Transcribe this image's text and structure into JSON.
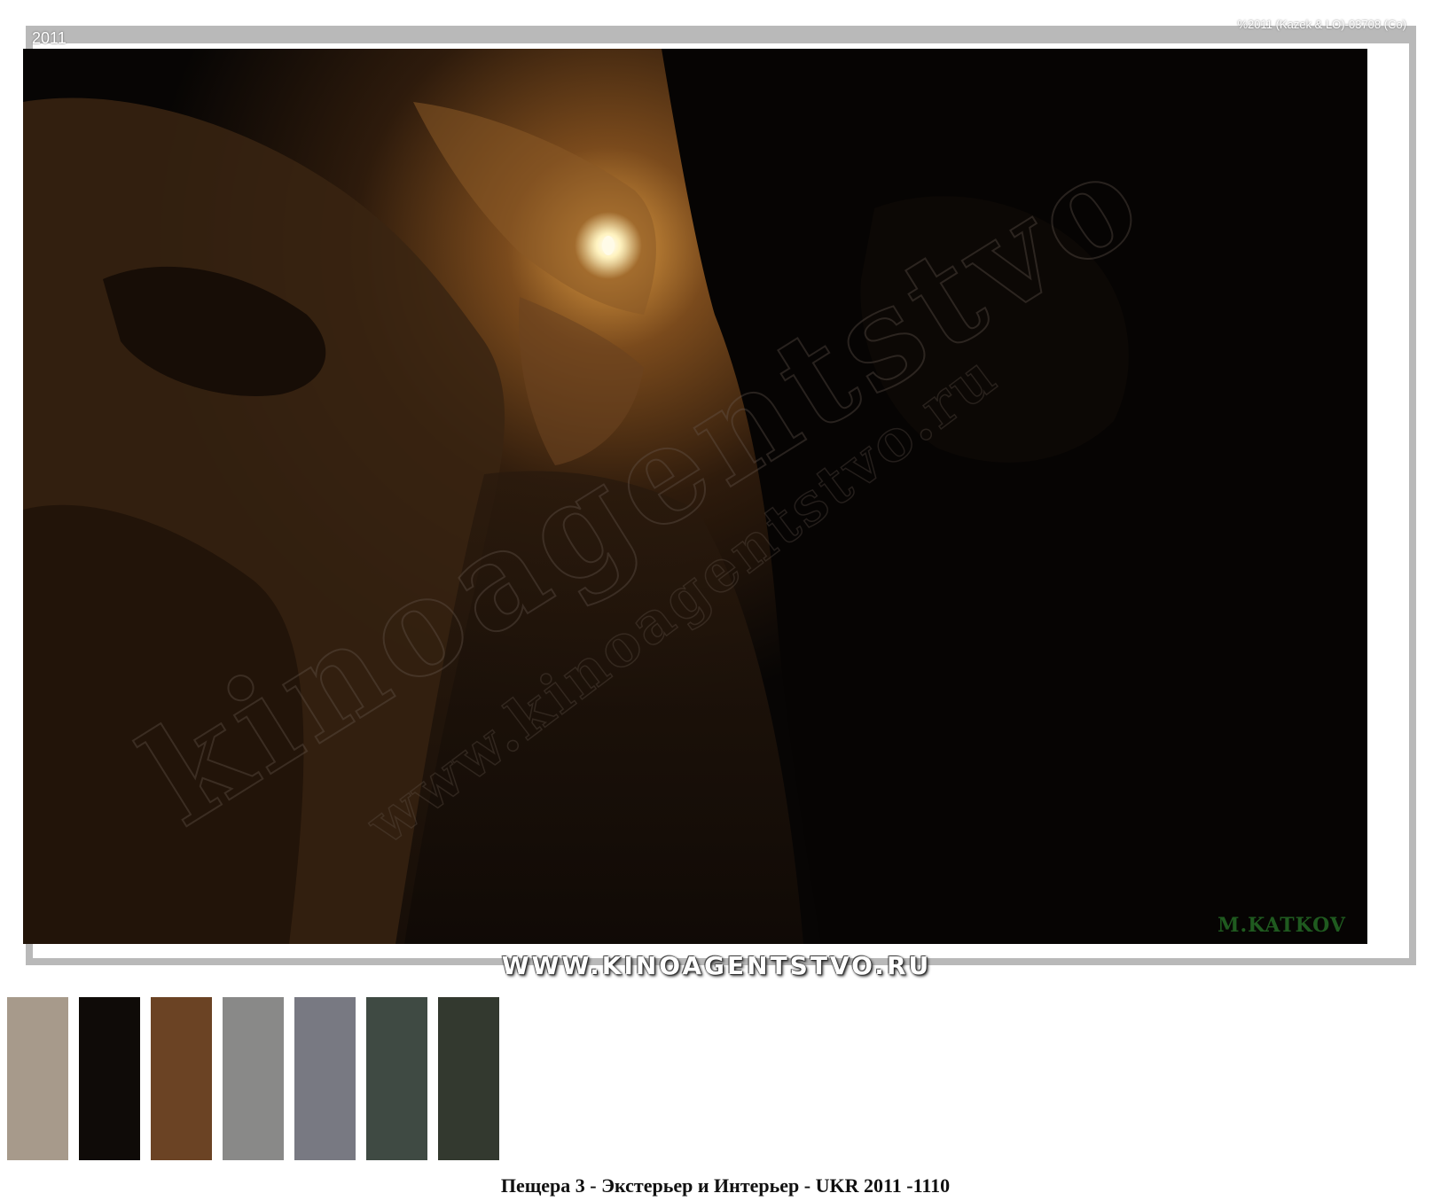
{
  "header": {
    "year": "2011",
    "copyright": "%2011 (Kazek & LO)-03708 (Co)"
  },
  "photo": {
    "watermark_large": "kinoagentstvo",
    "watermark_url": "www.kinoagentstvo.ru",
    "signature": "M.KATKOV",
    "colors": {
      "rock_light": "#7a4a1c",
      "rock_dark": "#1a0f07",
      "light": "#fff3c0",
      "shadow": "#050403"
    }
  },
  "banner": {
    "site": "WWW.KINOAGENTSTVO.RU"
  },
  "palette": {
    "swatches": [
      {
        "name": "swatch-taupe",
        "color": "#a79a8b"
      },
      {
        "name": "swatch-black",
        "color": "#0f0b08"
      },
      {
        "name": "swatch-brown",
        "color": "#6b4324"
      },
      {
        "name": "swatch-gray",
        "color": "#898988"
      },
      {
        "name": "swatch-slate",
        "color": "#787982"
      },
      {
        "name": "swatch-dark-green-gray",
        "color": "#3f4a43"
      },
      {
        "name": "swatch-charcoal-green",
        "color": "#33392f"
      }
    ]
  },
  "caption": {
    "text": "Пещера 3 - Экстерьер и Интерьер - UKR 2011 -1110"
  }
}
